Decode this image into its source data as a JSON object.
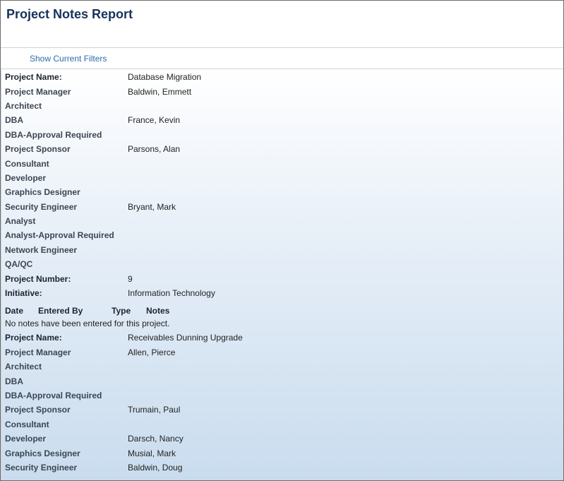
{
  "report": {
    "title": "Project Notes Report",
    "filters_link": "Show Current Filters"
  },
  "projects": [
    {
      "fields": [
        {
          "label": "Project Name:",
          "value": "Database Migration"
        },
        {
          "label": "Project Manager",
          "value": "Baldwin, Emmett"
        },
        {
          "label": "Architect",
          "value": ""
        },
        {
          "label": "DBA",
          "value": "France, Kevin"
        },
        {
          "label": "DBA-Approval Required",
          "value": ""
        },
        {
          "label": "Project Sponsor",
          "value": "Parsons, Alan"
        },
        {
          "label": "Consultant",
          "value": ""
        },
        {
          "label": "Developer",
          "value": ""
        },
        {
          "label": "Graphics Designer",
          "value": ""
        },
        {
          "label": "Security Engineer",
          "value": "Bryant, Mark"
        },
        {
          "label": "Analyst",
          "value": ""
        },
        {
          "label": "Analyst-Approval Required",
          "value": ""
        },
        {
          "label": "Network Engineer",
          "value": ""
        },
        {
          "label": "QA/QC",
          "value": ""
        },
        {
          "label": "Project Number:",
          "value": "9"
        },
        {
          "label": "Initiative:",
          "value": "Information Technology"
        }
      ],
      "notes_header": {
        "date": "Date",
        "entered_by": "Entered By",
        "type": "Type",
        "notes": "Notes"
      },
      "notes_empty": "No notes have been entered for this project."
    },
    {
      "fields": [
        {
          "label": "Project Name:",
          "value": "Receivables Dunning Upgrade"
        },
        {
          "label": "Project Manager",
          "value": "Allen, Pierce"
        },
        {
          "label": "Architect",
          "value": ""
        },
        {
          "label": "DBA",
          "value": ""
        },
        {
          "label": "DBA-Approval Required",
          "value": ""
        },
        {
          "label": "Project Sponsor",
          "value": "Trumain, Paul"
        },
        {
          "label": "Consultant",
          "value": ""
        },
        {
          "label": "Developer",
          "value": "Darsch, Nancy"
        },
        {
          "label": "Graphics Designer",
          "value": "Musial, Mark"
        },
        {
          "label": "Security Engineer",
          "value": "Baldwin, Doug"
        }
      ]
    }
  ]
}
